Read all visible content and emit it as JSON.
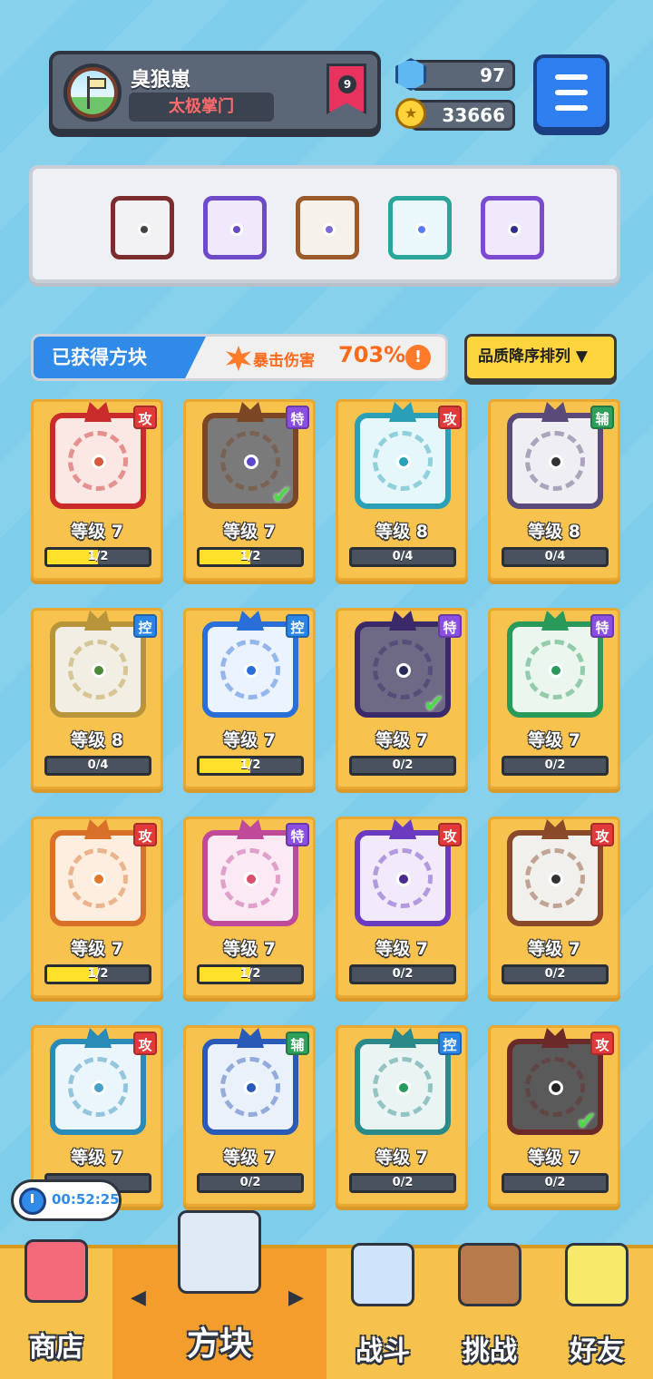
{
  "player": {
    "name": "臭狼崽",
    "title": "太极掌门",
    "rank": "9"
  },
  "resources": {
    "gems": "97",
    "coins": "33666"
  },
  "equipped": [
    {
      "icon": "blade-saw-block-icon",
      "frame": "#7b2c2c",
      "bg": "#f2f2f4",
      "core": "#444"
    },
    {
      "icon": "purple-arrow-block-icon",
      "frame": "#6c4ac8",
      "bg": "#efe9fb",
      "core": "#6c4ac8"
    },
    {
      "icon": "rainbow-infinity-block-icon",
      "frame": "#9b5a2a",
      "bg": "#f6f1ea",
      "core": "#7b6ad0"
    },
    {
      "icon": "teal-hands-block-icon",
      "frame": "#2aa59a",
      "bg": "#eaf7fb",
      "core": "#5b7cff"
    },
    {
      "icon": "purple-lightning-block-icon",
      "frame": "#7a4ad0",
      "bg": "#efe9fb",
      "core": "#2e2e8a"
    }
  ],
  "collected": {
    "tab_label": "已获得方块",
    "crit_label": "暴击伤害",
    "crit_value": "703%",
    "info_symbol": "!"
  },
  "sort_button": "品质降序排列 ▼",
  "blocks": [
    {
      "tag": "攻",
      "tag_type": "atk",
      "level": "等级 7",
      "progress": "1/2",
      "fill": 0.5,
      "frame": "#c92b2b",
      "bg": "#fbe7e3",
      "core": "#d65a3a",
      "checked": false
    },
    {
      "tag": "特",
      "tag_type": "spc",
      "level": "等级 7",
      "progress": "1/2",
      "fill": 0.5,
      "frame": "#7a4624",
      "bg": "#7a7a7a",
      "core": "#5a4ac8",
      "checked": true
    },
    {
      "tag": "攻",
      "tag_type": "atk",
      "level": "等级 8",
      "progress": "0/4",
      "fill": 0,
      "frame": "#2a9fb8",
      "bg": "#e6f7fb",
      "core": "#2a9fb8",
      "checked": false
    },
    {
      "tag": "辅",
      "tag_type": "sup",
      "level": "等级 8",
      "progress": "0/4",
      "fill": 0,
      "frame": "#5a4a7a",
      "bg": "#efeff3",
      "core": "#333",
      "checked": false
    },
    {
      "tag": "控",
      "tag_type": "ctl",
      "level": "等级 8",
      "progress": "0/4",
      "fill": 0,
      "frame": "#b8953a",
      "bg": "#f1eee4",
      "core": "#4e8a3a",
      "checked": false
    },
    {
      "tag": "控",
      "tag_type": "ctl",
      "level": "等级 7",
      "progress": "1/2",
      "fill": 0.5,
      "frame": "#2a6ed8",
      "bg": "#eaf3ff",
      "core": "#2a6ed8",
      "checked": false
    },
    {
      "tag": "特",
      "tag_type": "spc",
      "level": "等级 7",
      "progress": "0/2",
      "fill": 0,
      "frame": "#3a2a6a",
      "bg": "#6e6a86",
      "core": "#2a2a5a",
      "checked": true
    },
    {
      "tag": "特",
      "tag_type": "spc",
      "level": "等级 7",
      "progress": "0/2",
      "fill": 0,
      "frame": "#2a9a5a",
      "bg": "#eaf6ee",
      "core": "#2a9a5a",
      "checked": false
    },
    {
      "tag": "攻",
      "tag_type": "atk",
      "level": "等级 7",
      "progress": "1/2",
      "fill": 0.5,
      "frame": "#d8702a",
      "bg": "#fdeee0",
      "core": "#e07a2a",
      "checked": false
    },
    {
      "tag": "特",
      "tag_type": "spc",
      "level": "等级 7",
      "progress": "1/2",
      "fill": 0.5,
      "frame": "#c04a9a",
      "bg": "#fbe9f4",
      "core": "#d8506a",
      "checked": false
    },
    {
      "tag": "攻",
      "tag_type": "atk",
      "level": "等级 7",
      "progress": "0/2",
      "fill": 0,
      "frame": "#6a3ac0",
      "bg": "#f0eafb",
      "core": "#4a2a8a",
      "checked": false
    },
    {
      "tag": "攻",
      "tag_type": "atk",
      "level": "等级 7",
      "progress": "0/2",
      "fill": 0,
      "frame": "#8a4a2a",
      "bg": "#f2f0ec",
      "core": "#333",
      "checked": false
    },
    {
      "tag": "攻",
      "tag_type": "atk",
      "level": "等级 7",
      "progress": "",
      "fill": 0,
      "frame": "#2a8ab8",
      "bg": "#eaf6fb",
      "core": "#4aa0c8",
      "checked": false
    },
    {
      "tag": "辅",
      "tag_type": "sup",
      "level": "等级 7",
      "progress": "0/2",
      "fill": 0,
      "frame": "#2a5ab8",
      "bg": "#eaf1fb",
      "core": "#2a5ab8",
      "checked": false
    },
    {
      "tag": "控",
      "tag_type": "ctl",
      "level": "等级 7",
      "progress": "0/2",
      "fill": 0,
      "frame": "#2a8a8a",
      "bg": "#eaf5f3",
      "core": "#2a9a5a",
      "checked": false
    },
    {
      "tag": "攻",
      "tag_type": "atk",
      "level": "等级 7",
      "progress": "0/2",
      "fill": 0,
      "frame": "#6a2a2a",
      "bg": "#5a5a5a",
      "core": "#222",
      "checked": true
    }
  ],
  "timer": "00:52:25",
  "nav": {
    "shop": "商店",
    "blocks": "方块",
    "battle": "战斗",
    "challenge": "挑战",
    "friends": "好友",
    "prev_arrow": "◀",
    "next_arrow": "▶"
  },
  "colors": {
    "background": "#7ecdea",
    "card": "#f8c24e",
    "accent_blue": "#2f8ae8",
    "crit_orange": "#ff6a1a"
  }
}
